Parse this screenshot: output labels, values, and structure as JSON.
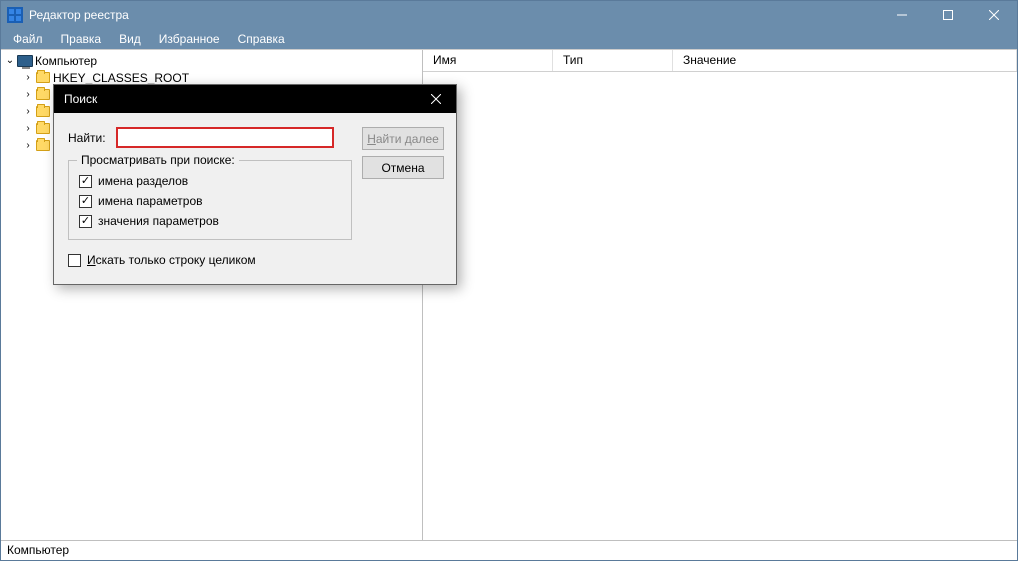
{
  "titlebar": {
    "title": "Редактор реестра"
  },
  "menubar": {
    "items": [
      "Файл",
      "Правка",
      "Вид",
      "Избранное",
      "Справка"
    ]
  },
  "tree": {
    "root": "Компьютер",
    "children": [
      "HKEY_CLASSES_ROOT"
    ]
  },
  "list": {
    "columns": {
      "name": "Имя",
      "type": "Тип",
      "value": "Значение"
    }
  },
  "dialog": {
    "title": "Поиск",
    "find_label": "Найти:",
    "find_value": "",
    "group_label": "Просматривать при поиске:",
    "opt_keys": "имена разделов",
    "opt_values": "имена параметров",
    "opt_data": "значения параметров",
    "opt_whole": "Искать только строку целиком",
    "btn_findnext": "Найти далее",
    "btn_cancel": "Отмена"
  },
  "statusbar": {
    "path": "Компьютер"
  }
}
